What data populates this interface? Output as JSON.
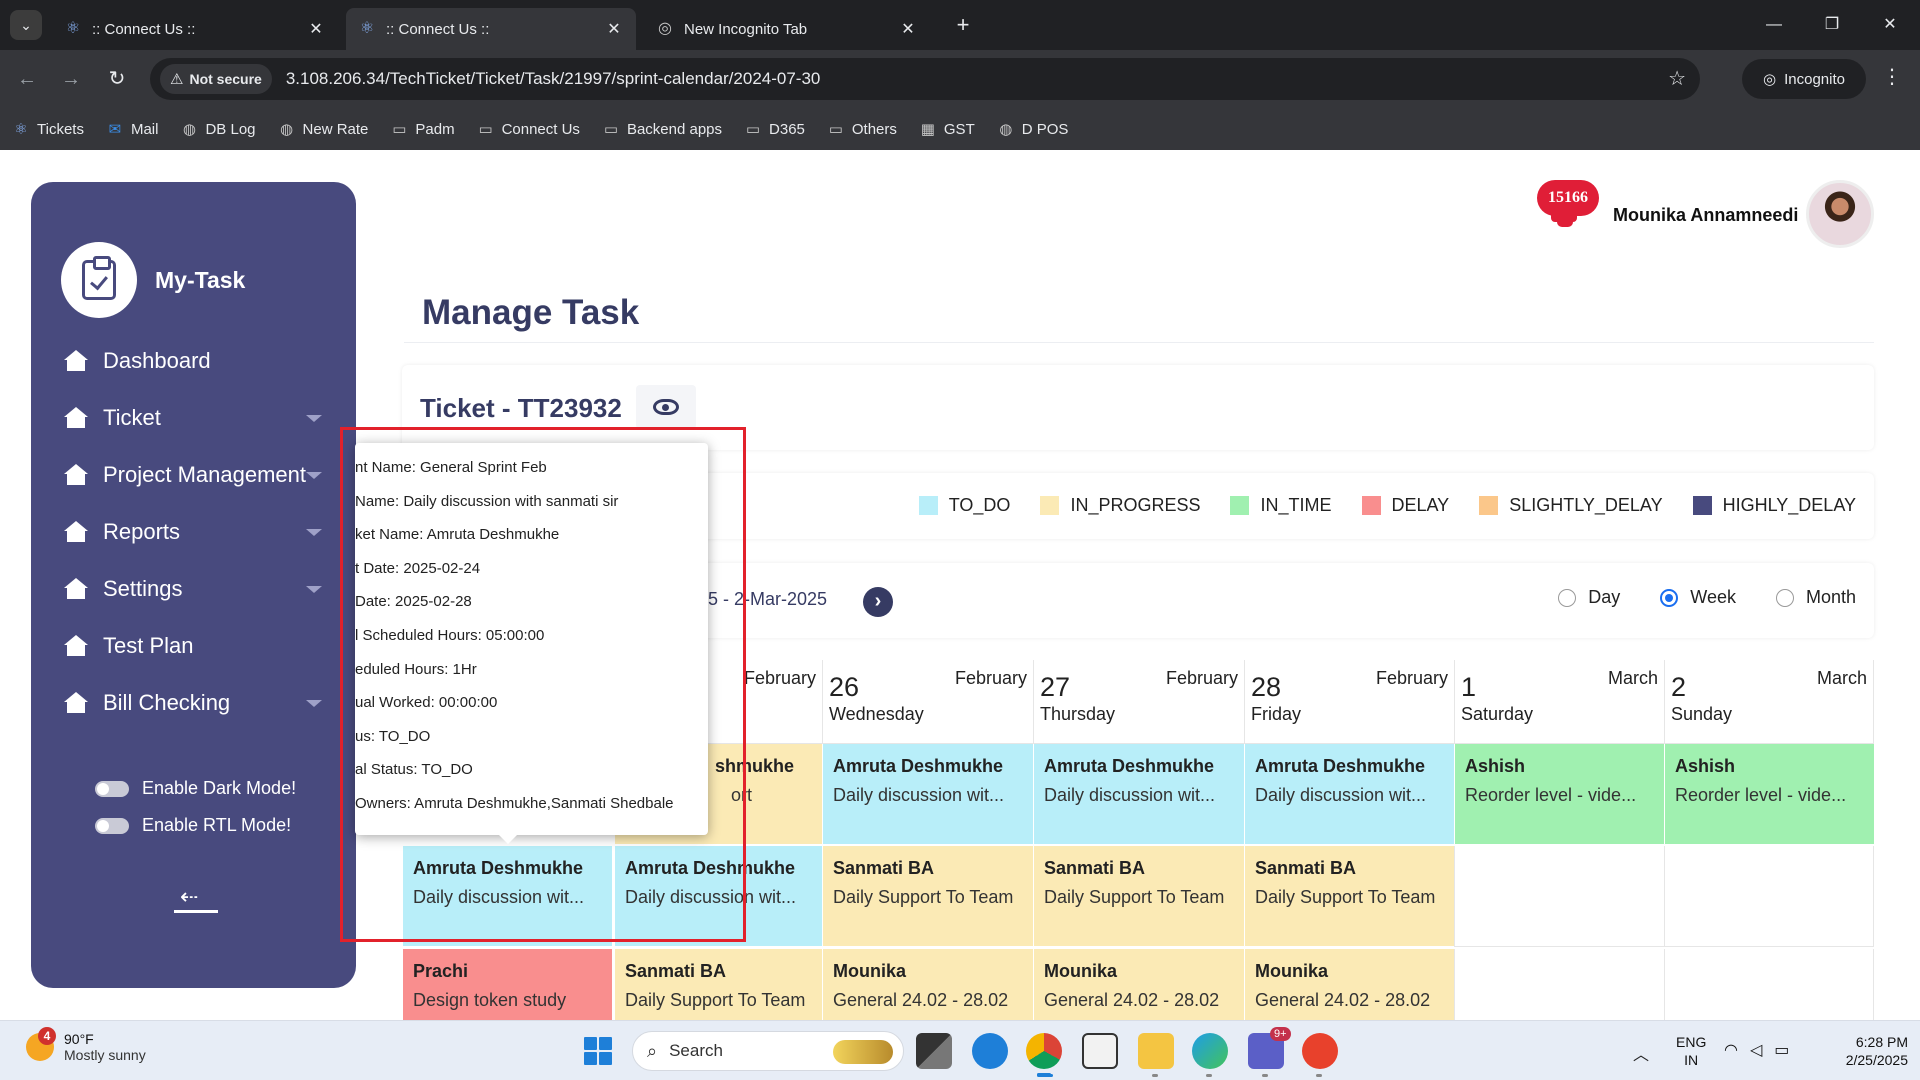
{
  "browser": {
    "tabs": [
      {
        "title": ":: Connect Us ::",
        "active": false
      },
      {
        "title": ":: Connect Us ::",
        "active": true
      },
      {
        "title": "New Incognito Tab",
        "active": false
      }
    ],
    "not_secure_label": "Not secure",
    "url": "3.108.206.34/TechTicket/Ticket/Task/21997/sprint-calendar/2024-07-30",
    "incognito_label": "Incognito",
    "bookmarks": [
      "Tickets",
      "Mail",
      "DB Log",
      "New Rate",
      "Padm",
      "Connect Us",
      "Backend apps",
      "D365",
      "Others",
      "GST",
      "D POS"
    ]
  },
  "sidebar": {
    "brand": "My-Task",
    "items": [
      {
        "label": "Dashboard",
        "has_caret": false
      },
      {
        "label": "Ticket",
        "has_caret": true
      },
      {
        "label": "Project Management",
        "has_caret": true
      },
      {
        "label": "Reports",
        "has_caret": true
      },
      {
        "label": "Settings",
        "has_caret": true
      },
      {
        "label": "Test Plan",
        "has_caret": false
      },
      {
        "label": "Bill Checking",
        "has_caret": true
      }
    ],
    "dark_mode_label": "Enable Dark Mode!",
    "rtl_mode_label": "Enable RTL Mode!"
  },
  "header": {
    "notification_count": "15166",
    "user_name": "Mounika Annamneedi"
  },
  "main": {
    "page_title": "Manage Task",
    "ticket_title": "Ticket - TT23932",
    "legend": [
      {
        "label": "TO_DO",
        "color": "#b8eef9"
      },
      {
        "label": "IN_PROGRESS",
        "color": "#fbeab5"
      },
      {
        "label": "IN_TIME",
        "color": "#a0f0b0"
      },
      {
        "label": "DELAY",
        "color": "#f98e8e"
      },
      {
        "label": "SLIGHTLY_DELAY",
        "color": "#fbc78a"
      },
      {
        "label": "HIGHLY_DELAY",
        "color": "#484a7e"
      }
    ],
    "date_range_visible": "25 - 2-Mar-2025",
    "view_options": [
      {
        "label": "Day",
        "selected": false
      },
      {
        "label": "Week",
        "selected": true
      },
      {
        "label": "Month",
        "selected": false
      }
    ]
  },
  "calendar": {
    "days": [
      {
        "num": "",
        "month": "February",
        "name": ""
      },
      {
        "num": "26",
        "month": "February",
        "name": "Wednesday"
      },
      {
        "num": "27",
        "month": "February",
        "name": "Thursday"
      },
      {
        "num": "28",
        "month": "February",
        "name": "Friday"
      },
      {
        "num": "1",
        "month": "March",
        "name": "Saturday"
      },
      {
        "num": "2",
        "month": "March",
        "name": "Sunday"
      }
    ],
    "rows": [
      [
        {
          "name": "",
          "task": "",
          "status": "none"
        },
        {
          "name": "shmukhe",
          "task": "ort",
          "status": "in_progress"
        },
        {
          "name": "Amruta Deshmukhe",
          "task": "Daily discussion wit...",
          "status": "to_do"
        },
        {
          "name": "Amruta Deshmukhe",
          "task": "Daily discussion wit...",
          "status": "to_do"
        },
        {
          "name": "Amruta Deshmukhe",
          "task": "Daily discussion wit...",
          "status": "to_do"
        },
        {
          "name": "Ashish",
          "task": "Reorder level - vide...",
          "status": "in_time"
        },
        {
          "name": "Ashish",
          "task": "Reorder level - vide...",
          "status": "in_time"
        }
      ],
      [
        {
          "name": "Amruta Deshmukhe",
          "task": "Daily discussion wit...",
          "status": "to_do"
        },
        {
          "name": "Amruta Deshmukhe",
          "task": "Daily discussion wit...",
          "status": "to_do"
        },
        {
          "name": "Sanmati BA",
          "task": "Daily Support To Team",
          "status": "in_progress"
        },
        {
          "name": "Sanmati BA",
          "task": "Daily Support To Team",
          "status": "in_progress"
        },
        {
          "name": "Sanmati BA",
          "task": "Daily Support To Team",
          "status": "in_progress"
        },
        {
          "name": "",
          "task": "",
          "status": "empty"
        },
        {
          "name": "",
          "task": "",
          "status": "empty"
        }
      ],
      [
        {
          "name": "Prachi",
          "task": "Design token study",
          "status": "delay"
        },
        {
          "name": "Sanmati BA",
          "task": "Daily Support To Team",
          "status": "in_progress"
        },
        {
          "name": "Mounika",
          "task": "General 24.02 - 28.02",
          "status": "in_progress"
        },
        {
          "name": "Mounika",
          "task": "General 24.02 - 28.02",
          "status": "in_progress"
        },
        {
          "name": "Mounika",
          "task": "General 24.02 - 28.02",
          "status": "in_progress"
        },
        {
          "name": "",
          "task": "",
          "status": "empty"
        },
        {
          "name": "",
          "task": "",
          "status": "empty"
        }
      ]
    ]
  },
  "tooltip": {
    "rows": [
      "nt Name: General Sprint Feb",
      " Name: Daily discussion with sanmati sir",
      "ket Name: Amruta Deshmukhe",
      "t Date: 2025-02-24",
      " Date: 2025-02-28",
      "l Scheduled Hours: 05:00:00",
      "eduled Hours: 1Hr",
      "ual Worked: 00:00:00",
      "us: TO_DO",
      "al Status: TO_DO",
      " Owners: Amruta Deshmukhe,Sanmati Shedbale"
    ]
  },
  "taskbar": {
    "weather_badge": "4",
    "weather_temp": "90°F",
    "weather_desc": "Mostly sunny",
    "search_placeholder": "Search",
    "lang_line1": "ENG",
    "lang_line2": "IN",
    "time": "6:28 PM",
    "date": "2/25/2025",
    "teams_badge": "9+"
  },
  "colors": {
    "to_do": "#b8eef9",
    "in_progress": "#fbeab5",
    "in_time": "#a0f0b0",
    "delay": "#f98e8e",
    "sidebar": "#484a7e",
    "highlight": "#e2212b"
  }
}
